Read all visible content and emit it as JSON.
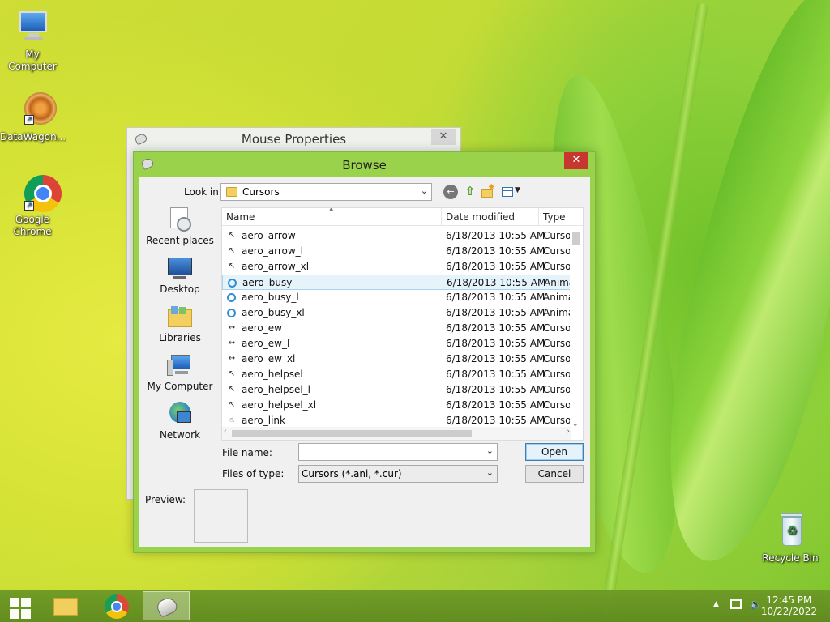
{
  "desktop": {
    "icons": [
      {
        "label": "My Computer"
      },
      {
        "label": "DataWagon..."
      },
      {
        "label": "Google Chrome"
      },
      {
        "label": "Recycle Bin"
      }
    ]
  },
  "mouse_properties": {
    "title": "Mouse Properties"
  },
  "browse": {
    "title": "Browse",
    "look_in_label": "Look in:",
    "look_in_value": "Cursors",
    "places": [
      {
        "label": "Recent places",
        "icon": "recent-places-icon"
      },
      {
        "label": "Desktop",
        "icon": "desktop-icon"
      },
      {
        "label": "Libraries",
        "icon": "libraries-icon"
      },
      {
        "label": "My Computer",
        "icon": "computer-icon"
      },
      {
        "label": "Network",
        "icon": "network-icon"
      }
    ],
    "columns": {
      "name": "Name",
      "date": "Date modified",
      "type": "Type"
    },
    "files": [
      {
        "name": "aero_arrow",
        "date": "6/18/2013 10:55 AM",
        "type": "Cursor",
        "icon": "arrow-cursor-icon"
      },
      {
        "name": "aero_arrow_l",
        "date": "6/18/2013 10:55 AM",
        "type": "Cursor",
        "icon": "arrow-cursor-icon"
      },
      {
        "name": "aero_arrow_xl",
        "date": "6/18/2013 10:55 AM",
        "type": "Cursor",
        "icon": "arrow-cursor-icon"
      },
      {
        "name": "aero_busy",
        "date": "6/18/2013 10:55 AM",
        "type": "Anima",
        "icon": "busy-cursor-icon"
      },
      {
        "name": "aero_busy_l",
        "date": "6/18/2013 10:55 AM",
        "type": "Anima",
        "icon": "busy-cursor-icon"
      },
      {
        "name": "aero_busy_xl",
        "date": "6/18/2013 10:55 AM",
        "type": "Anima",
        "icon": "busy-cursor-icon"
      },
      {
        "name": "aero_ew",
        "date": "6/18/2013 10:55 AM",
        "type": "Cursor",
        "icon": "ew-cursor-icon"
      },
      {
        "name": "aero_ew_l",
        "date": "6/18/2013 10:55 AM",
        "type": "Cursor",
        "icon": "ew-cursor-icon"
      },
      {
        "name": "aero_ew_xl",
        "date": "6/18/2013 10:55 AM",
        "type": "Cursor",
        "icon": "ew-cursor-icon"
      },
      {
        "name": "aero_helpsel",
        "date": "6/18/2013 10:55 AM",
        "type": "Cursor",
        "icon": "helpsel-cursor-icon"
      },
      {
        "name": "aero_helpsel_l",
        "date": "6/18/2013 10:55 AM",
        "type": "Cursor",
        "icon": "helpsel-cursor-icon"
      },
      {
        "name": "aero_helpsel_xl",
        "date": "6/18/2013 10:55 AM",
        "type": "Cursor",
        "icon": "helpsel-cursor-icon"
      },
      {
        "name": "aero_link",
        "date": "6/18/2013 10:55 AM",
        "type": "Cursor",
        "icon": "link-cursor-icon"
      }
    ],
    "selected_file": "aero_busy",
    "file_name_label": "File name:",
    "file_name_value": "",
    "file_type_label": "Files of type:",
    "file_type_value": "Cursors (*.ani, *.cur)",
    "open_label": "Open",
    "cancel_label": "Cancel",
    "preview_label": "Preview:"
  },
  "taskbar": {
    "time": "12:45 PM",
    "date": "10/22/2022"
  },
  "colors": {
    "accent": "#9bd24c",
    "close_red": "#c7372f",
    "selection": "#e5f3fb"
  }
}
